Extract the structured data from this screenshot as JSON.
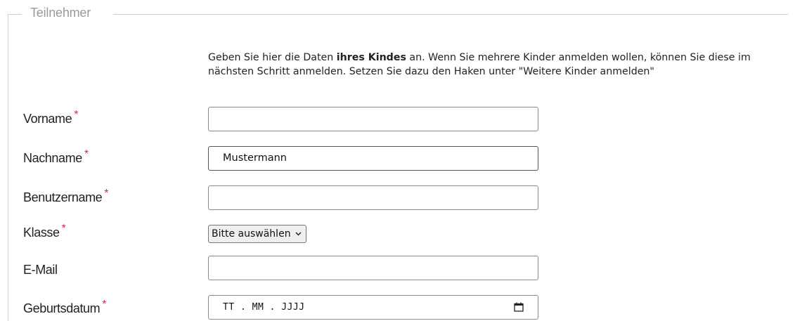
{
  "fieldset": {
    "legend": "Teilnehmer"
  },
  "intro": {
    "text_before": "Geben Sie hier die Daten ",
    "text_bold": "ihres Kindes",
    "text_after": " an. Wenn Sie mehrere Kinder anmelden wollen, können Sie diese im nächsten Schritt anmelden. Setzen Sie dazu den Haken unter \"Weitere Kinder anmelden\""
  },
  "required_marker": "*",
  "fields": {
    "vorname": {
      "label": "Vorname",
      "value": "",
      "required": true
    },
    "nachname": {
      "label": "Nachname",
      "value": "Mustermann",
      "required": true
    },
    "benutzername": {
      "label": "Benutzername",
      "value": "",
      "required": true
    },
    "klasse": {
      "label": "Klasse",
      "selected": "Bitte auswählen",
      "required": true
    },
    "email": {
      "label": "E-Mail",
      "value": "",
      "required": false
    },
    "geburtsdatum": {
      "label": "Geburtsdatum",
      "placeholder": "TT . MM . JJJJ",
      "required": true
    }
  },
  "colors": {
    "required": "#e0283c",
    "legend": "#9a9a9a",
    "border": "#cfcfcf"
  }
}
